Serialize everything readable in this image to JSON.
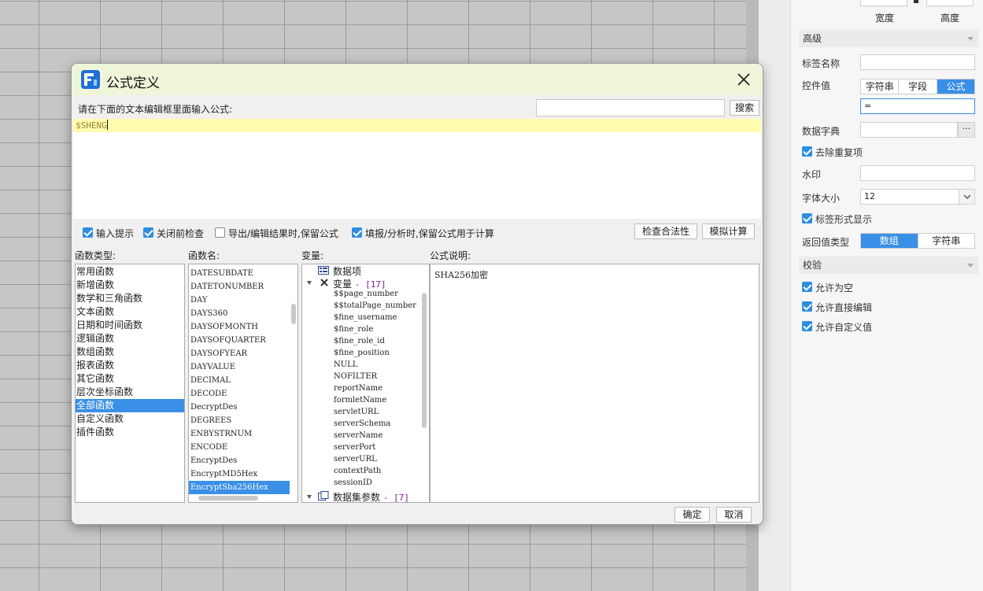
{
  "dialog": {
    "title": "公式定义",
    "prompt": "请在下面的文本编辑框里面输入公式:",
    "search_placeholder": "",
    "search_button": "搜索",
    "formula": "$SHENG",
    "options": [
      {
        "label": "输入提示",
        "checked": true
      },
      {
        "label": "关闭前检查",
        "checked": true
      },
      {
        "label": "导出/编辑结果时,保留公式",
        "checked": false
      },
      {
        "label": "填报/分析时,保留公式用于计算",
        "checked": true
      }
    ],
    "check_button": "检查合法性",
    "simulate_button": "模拟计算",
    "category_label": "函数类型:",
    "function_label": "函数名:",
    "variable_label": "变量:",
    "description_label": "公式说明:",
    "categories": [
      "常用函数",
      "新增函数",
      "数学和三角函数",
      "文本函数",
      "日期和时间函数",
      "逻辑函数",
      "数组函数",
      "报表函数",
      "其它函数",
      "层次坐标函数",
      "全部函数",
      "自定义函数",
      "插件函数"
    ],
    "selected_category": 10,
    "functions": [
      "DATESUBDATE",
      "DATETONUMBER",
      "DAY",
      "DAYS360",
      "DAYSOFMONTH",
      "DAYSOFQUARTER",
      "DAYSOFYEAR",
      "DAYVALUE",
      "DECIMAL",
      "DECODE",
      "DecryptDes",
      "DEGREES",
      "ENBYSTRNUM",
      "ENCODE",
      "EncryptDes",
      "EncryptMD5Hex",
      "EncryptSha256Hex"
    ],
    "selected_function": 16,
    "variables": {
      "data_items": "数据项",
      "variables_group": "变量",
      "variables_count": "- [17]",
      "items": [
        "$$page_number",
        "$$totalPage_number",
        "$fine_username",
        "$fine_role",
        "$fine_role_id",
        "$fine_position",
        "NULL",
        "NOFILTER",
        "reportName",
        "formletName",
        "servletURL",
        "serverSchema",
        "serverName",
        "serverPort",
        "serverURL",
        "contextPath",
        "sessionID"
      ],
      "dataset_group": "数据集参数",
      "dataset_count": "- [7]"
    },
    "description": "SHA256加密",
    "ok_button": "确定",
    "cancel_button": "取消"
  },
  "panel": {
    "width_label": "宽度",
    "height_label": "高度",
    "advanced_section": "高级",
    "tag_name_label": "标签名称",
    "tag_name_value": "",
    "control_value_label": "控件值",
    "control_value_tabs": [
      "字符串",
      "字段",
      "公式"
    ],
    "control_value_active": 2,
    "control_value_input": "=",
    "dictionary_label": "数据字典",
    "dictionary_value": "",
    "dictionary_more": "···",
    "dedupe_label": "去除重复项",
    "watermark_label": "水印",
    "watermark_value": "",
    "font_size_label": "字体大小",
    "font_size_value": "12",
    "tag_display_label": "标签形式显示",
    "return_type_label": "返回值类型",
    "return_type_tabs": [
      "数组",
      "字符串"
    ],
    "return_type_active": 0,
    "validation_section": "校验",
    "allow_empty_label": "允许为空",
    "allow_direct_edit_label": "允许直接编辑",
    "allow_custom_label": "允许自定义值"
  },
  "colors": {
    "accent": "#3a8fe6",
    "titlebar": "#eef5d9",
    "editor_highlight": "#fffcae"
  }
}
